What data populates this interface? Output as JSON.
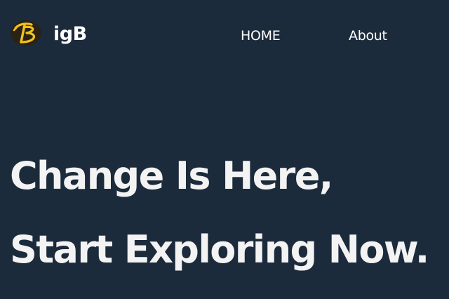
{
  "brand": {
    "logo_icon": "bigb-logo-icon",
    "logo_letter": "B",
    "name": "igB"
  },
  "nav": {
    "items": [
      {
        "label": "HOME"
      },
      {
        "label": "About"
      }
    ]
  },
  "hero": {
    "line1": "Change Is Here,",
    "line2": "Start Exploring Now."
  },
  "colors": {
    "background": "#1c2b3b",
    "text": "#ffffff",
    "logo_yellow": "#f2c21b",
    "logo_dark": "#2a2217"
  }
}
